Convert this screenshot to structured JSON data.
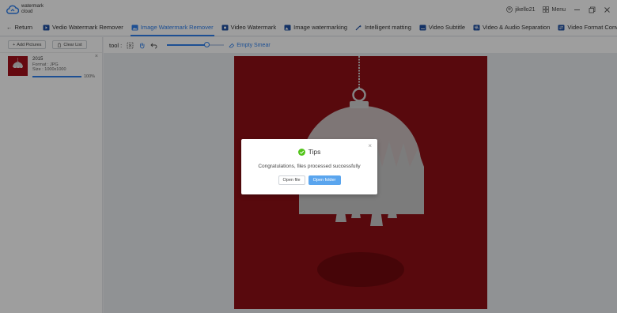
{
  "app": {
    "logo_line1": "watermark",
    "logo_line2": "cloud",
    "username": "jikello21",
    "menu_label": "Menu"
  },
  "nav": {
    "return_label": "Return",
    "tabs": [
      {
        "label": "Vedio Watermark Remover",
        "icon": "video-remove-icon",
        "active": false
      },
      {
        "label": "Image Watermark Remover",
        "icon": "image-remove-icon",
        "active": true
      },
      {
        "label": "Video Watermark",
        "icon": "video-watermark-icon",
        "active": false
      },
      {
        "label": "Image watermarking",
        "icon": "image-watermark-icon",
        "active": false
      },
      {
        "label": "Intelligent matting",
        "icon": "matting-wand-icon",
        "active": false
      },
      {
        "label": "Video Subtitle",
        "icon": "subtitle-icon",
        "active": false
      },
      {
        "label": "Video & Audio Separation",
        "icon": "audio-separation-icon",
        "active": false
      },
      {
        "label": "Video Format Converting",
        "icon": "format-convert-icon",
        "active": false
      }
    ]
  },
  "left_panel": {
    "add_label": "Add Pictures",
    "clear_label": "Clear List",
    "files": [
      {
        "name": "2015",
        "format": "Format : JPG",
        "size": "Size : 1000x1000",
        "progress_percent": 100,
        "progress_label": "100%"
      }
    ]
  },
  "toolbar": {
    "tool_label": "tool :",
    "brush_size_fraction": 0.7,
    "empty_smear_label": "Empty Smear"
  },
  "dialog": {
    "title": "Tips",
    "message": "Congratulations, files processed successfully",
    "open_file_label": "Open file",
    "open_folder_label": "Open folder"
  },
  "colors": {
    "accent": "#2f80ed",
    "artwork_bg": "#8e0f16",
    "success": "#52c41a"
  }
}
